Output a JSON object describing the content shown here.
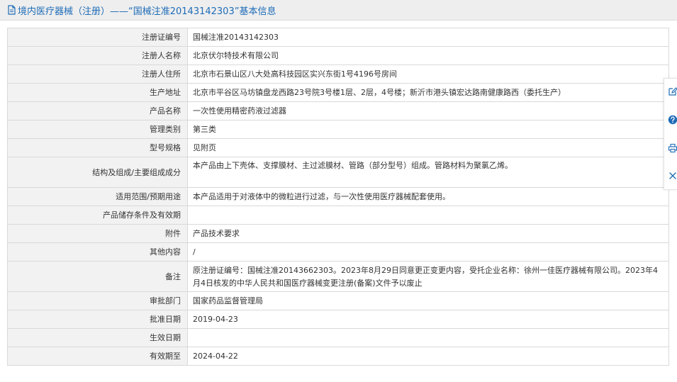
{
  "header": {
    "title": "境内医疗器械（注册）——“国械注准20143142303”基本信息",
    "icon": "document-icon",
    "color": "#1e6cb8"
  },
  "rows": [
    {
      "label": "注册证编号",
      "value": "国械注准20143142303"
    },
    {
      "label": "注册人名称",
      "value": "北京伏尔特技术有限公司"
    },
    {
      "label": "注册人住所",
      "value": "北京市石景山区八大处高科技园区实兴东街1号4196号房间"
    },
    {
      "label": "生产地址",
      "value": "北京市平谷区马坊镇盘龙西路23号院3号楼1层、2层，4号楼；新沂市港头镇宏达路南健康路西（委托生产）"
    },
    {
      "label": "产品名称",
      "value": "一次性使用精密药液过滤器"
    },
    {
      "label": "管理类别",
      "value": "第三类"
    },
    {
      "label": "型号规格",
      "value": "见附页"
    },
    {
      "label": "结构及组成/主要组成成分",
      "value": "本产品由上下壳体、支撑膜材、主过滤膜材、管路（部分型号）组成。管路材料为聚氯乙烯。"
    },
    {
      "label": "适用范围/预期用途",
      "value": "本产品适用于对液体中的微粒进行过滤，与一次性使用医疗器械配套使用。"
    },
    {
      "label": "产品储存条件及有效期",
      "value": ""
    },
    {
      "label": "附件",
      "value": "产品技术要求"
    },
    {
      "label": "其他内容",
      "value": "/"
    },
    {
      "label": "备注",
      "value": "原注册证编号：国械注准20143662303。2023年8月29日同意更正变更内容，受托企业名称：徐州一佳医疗器械有限公司。2023年4月4日核发的中华人民共和国医疗器械变更注册(备案)文件予以废止"
    },
    {
      "label": "审批部门",
      "value": "国家药品监督管理局"
    },
    {
      "label": "批准日期",
      "value": "2019-04-23"
    },
    {
      "label": "生效日期",
      "value": ""
    },
    {
      "label": "有效期至",
      "value": "2024-04-22"
    }
  ],
  "side_toolbar": {
    "buttons": [
      {
        "icon": "edit-icon"
      },
      {
        "icon": "help-icon"
      },
      {
        "icon": "print-icon"
      },
      {
        "icon": "close-icon"
      }
    ],
    "color": "#1e6cb8"
  }
}
